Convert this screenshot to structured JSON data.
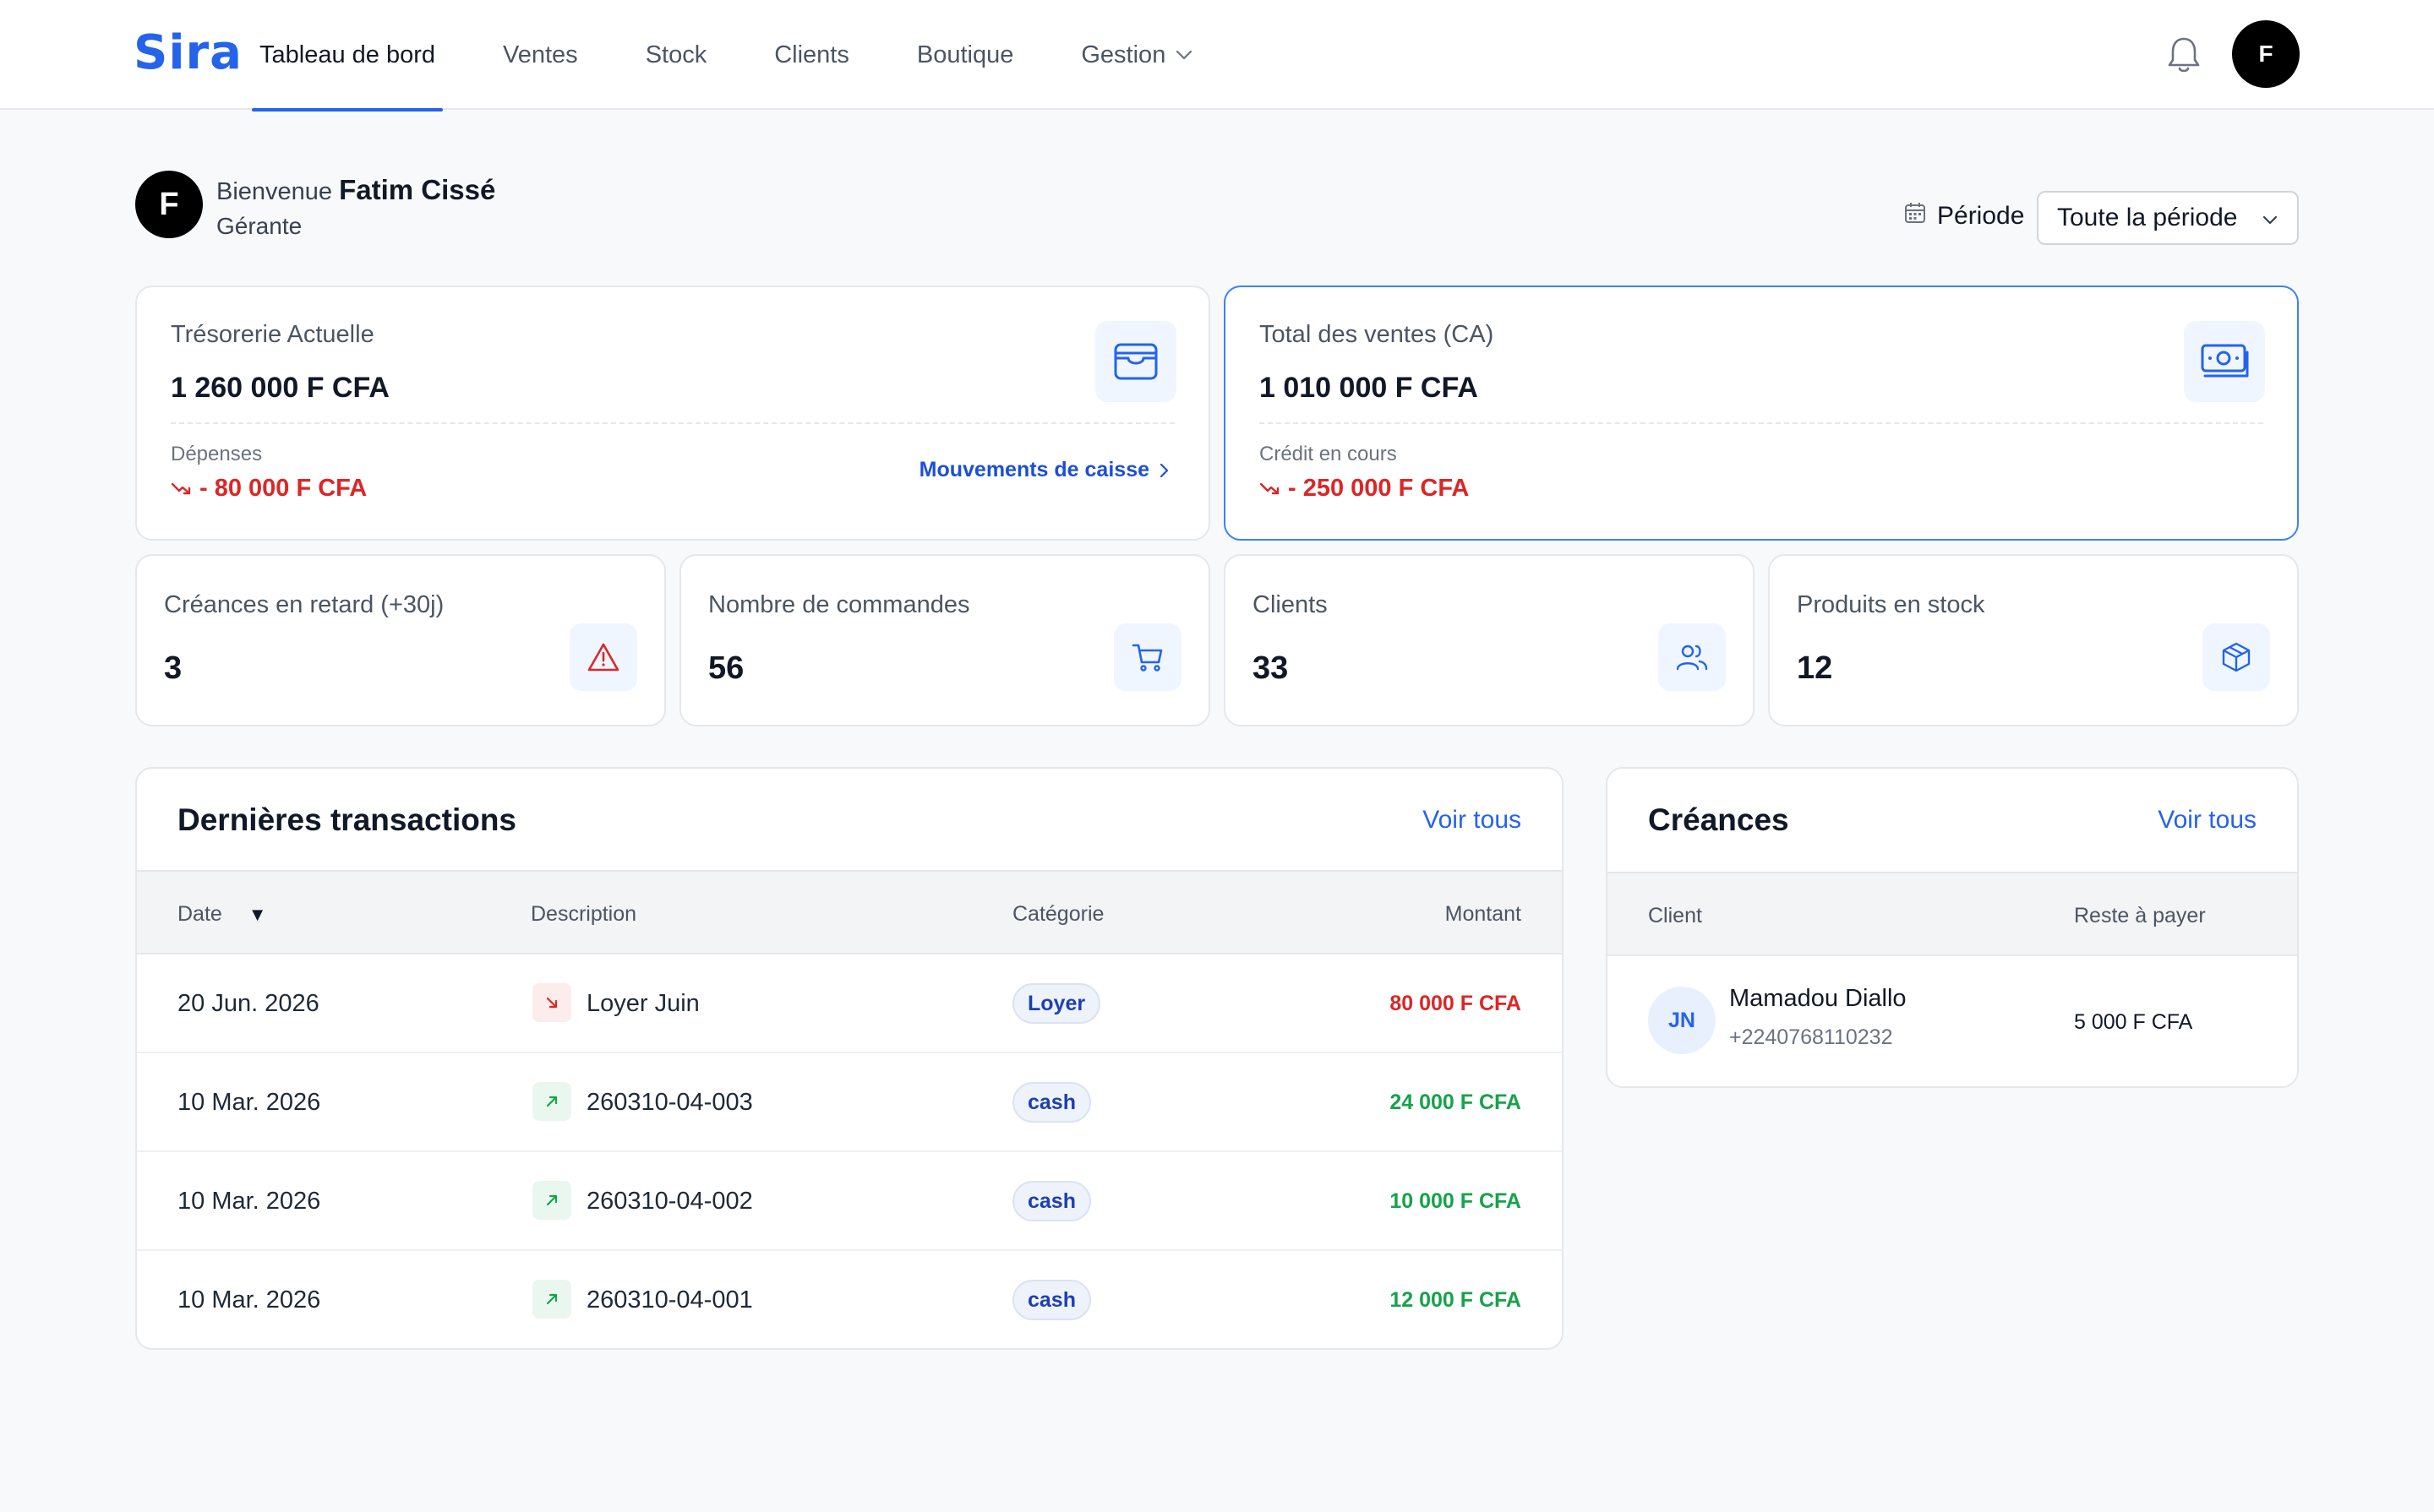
{
  "app": {
    "logo": "Sira"
  },
  "nav": {
    "items": [
      "Tableau de bord",
      "Ventes",
      "Stock",
      "Clients",
      "Boutique",
      "Gestion"
    ],
    "active": "Tableau de bord"
  },
  "user": {
    "initial": "F",
    "greeting": "Bienvenue",
    "name": "Fatim Cissé",
    "role": "Gérante"
  },
  "period": {
    "label": "Période",
    "selected": "Toute la période"
  },
  "treasury": {
    "title": "Trésorerie Actuelle",
    "value": "1 260 000 F CFA",
    "sub_title": "Dépenses",
    "sub_value": "- 80 000 F CFA",
    "link": "Mouvements de caisse"
  },
  "sales": {
    "title": "Total des ventes (CA)",
    "value": "1 010 000 F CFA",
    "sub_title": "Crédit en cours",
    "sub_value": "- 250 000 F CFA"
  },
  "stats": [
    {
      "title": "Créances en retard (+30j)",
      "value": "3",
      "icon": "alert-triangle-icon"
    },
    {
      "title": "Nombre de commandes",
      "value": "56",
      "icon": "cart-icon"
    },
    {
      "title": "Clients",
      "value": "33",
      "icon": "users-icon"
    },
    {
      "title": "Produits en stock",
      "value": "12",
      "icon": "box-icon"
    }
  ],
  "transactions": {
    "title": "Dernières transactions",
    "link": "Voir tous",
    "headers": {
      "date": "Date",
      "sort": "▼",
      "description": "Description",
      "category": "Catégorie",
      "amount": "Montant"
    },
    "rows": [
      {
        "date": "20 Jun. 2026",
        "description": "Loyer Juin",
        "category": "Loyer",
        "amount": "80 000 F CFA",
        "direction": "out"
      },
      {
        "date": "10 Mar. 2026",
        "description": "260310-04-003",
        "category": "cash",
        "amount": "24 000 F CFA",
        "direction": "in"
      },
      {
        "date": "10 Mar. 2026",
        "description": "260310-04-002",
        "category": "cash",
        "amount": "10 000 F CFA",
        "direction": "in"
      },
      {
        "date": "10 Mar. 2026",
        "description": "260310-04-001",
        "category": "cash",
        "amount": "12 000 F CFA",
        "direction": "in"
      }
    ]
  },
  "debts": {
    "title": "Créances",
    "link": "Voir tous",
    "headers": {
      "client": "Client",
      "remaining": "Reste à payer"
    },
    "rows": [
      {
        "initials": "JN",
        "name": "Mamadou Diallo",
        "phone": "+2240768110232",
        "remaining": "5 000 F CFA"
      }
    ]
  },
  "colors": {
    "accent": "#2563eb",
    "negative": "#dc2626",
    "positive": "#16a34a"
  }
}
